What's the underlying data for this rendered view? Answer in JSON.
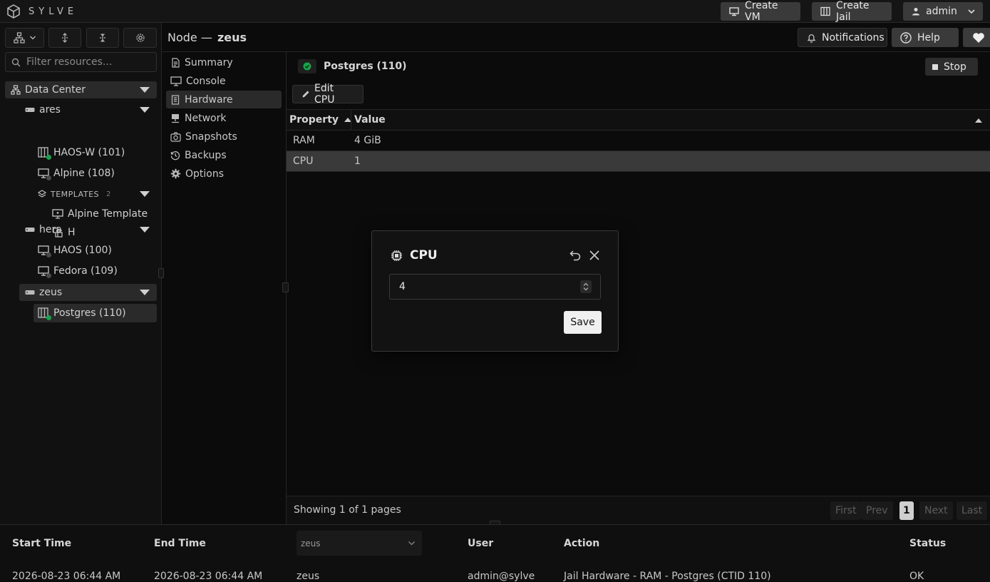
{
  "app": {
    "logo_text": "SYLVE"
  },
  "topbar": {
    "create_vm": "Create VM",
    "create_jail": "Create Jail",
    "user": "admin",
    "notifications": "Notifications",
    "help": "Help"
  },
  "sidebar": {
    "filter_placeholder": "Filter resources...",
    "datacenter": "Data Center",
    "nodes": [
      {
        "name": "ares",
        "items": [
          {
            "label": "HAOS-W (101)",
            "status": "running"
          },
          {
            "label": "Alpine (108)",
            "status": "stopped"
          }
        ],
        "templates_label": "TEMPLATES",
        "templates_count": "2",
        "templates": [
          "Alpine Template",
          "H"
        ]
      },
      {
        "name": "hera",
        "items": [
          {
            "label": "HAOS (100)",
            "status": "stopped"
          },
          {
            "label": "Fedora (109)",
            "status": "stopped"
          }
        ]
      },
      {
        "name": "zeus",
        "items": [
          {
            "label": "Postgres (110)",
            "status": "running"
          }
        ]
      }
    ]
  },
  "header": {
    "node_prefix": "Node —",
    "node_name": "zeus"
  },
  "nav": [
    "Summary",
    "Console",
    "Hardware",
    "Network",
    "Snapshots",
    "Backups",
    "Options"
  ],
  "main": {
    "resource_title": "Postgres (110)",
    "stop_label": "Stop",
    "edit_label": "Edit CPU",
    "columns": [
      "Property",
      "Value"
    ],
    "rows": [
      {
        "property": "RAM",
        "value": "4 GiB"
      },
      {
        "property": "CPU",
        "value": "1"
      }
    ],
    "pagination": {
      "summary": "Showing 1 of 1 pages",
      "first": "First",
      "prev": "Prev",
      "page": "1",
      "next": "Next",
      "last": "Last"
    }
  },
  "dialog": {
    "title": "CPU",
    "input_value": "4",
    "save_label": "Save"
  },
  "log": {
    "columns": [
      "Start Time",
      "End Time",
      "User",
      "Action",
      "Status"
    ],
    "node_filter": "zeus",
    "rows": [
      {
        "start": "2026-08-23 06:44 AM",
        "end": "2026-08-23 06:44 AM",
        "node": "zeus",
        "user": "admin@sylve",
        "action": "Jail Hardware - RAM - Postgres (CTID 110)",
        "status": "OK"
      }
    ]
  },
  "colors": {
    "running": "#16a34a",
    "stopped": "#4a4a4a",
    "accent": "#3a3a3a"
  }
}
